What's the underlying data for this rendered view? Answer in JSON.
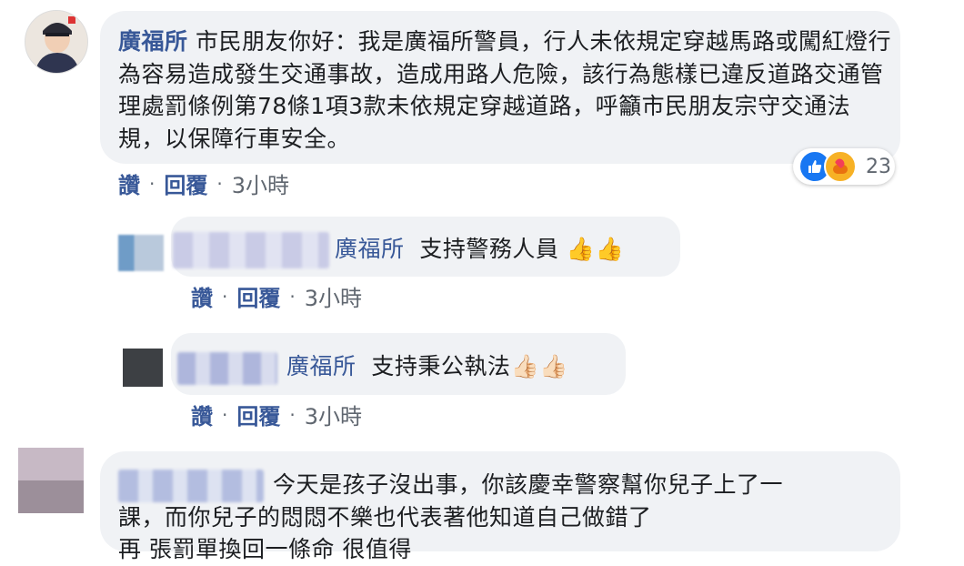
{
  "comments": [
    {
      "author": "廣福所",
      "text": "市民朋友你好：我是廣福所警員，行人未依規定穿越馬路或闖紅燈行為容易造成發生交通事故，造成用路人危險，該行為態樣已違反道路交通管理處罰條例第78條1項3款未依規定穿越道路，呼籲市民朋友宗守交通法規，以保障行車安全。",
      "actions": {
        "like": "讚",
        "reply": "回覆",
        "time": "3小時"
      },
      "reaction_count": "23"
    },
    {
      "mention": "廣福所",
      "text": "支持警務人員",
      "emoji": "👍👍",
      "actions": {
        "like": "讚",
        "reply": "回覆",
        "time": "3小時"
      }
    },
    {
      "mention": "廣福所",
      "text": "支持秉公執法",
      "emoji": "👍🏻👍🏻",
      "actions": {
        "like": "讚",
        "reply": "回覆",
        "time": "3小時"
      }
    },
    {
      "text_line1": "今天是孩子沒出事，你該慶幸警察幫你兒子上了一",
      "text_line2": "課，而你兒子的悶悶不樂也代表著他知道自己做錯了",
      "text_line3": "再 張罰單換回一條命 很值得"
    }
  ],
  "separator": "·"
}
